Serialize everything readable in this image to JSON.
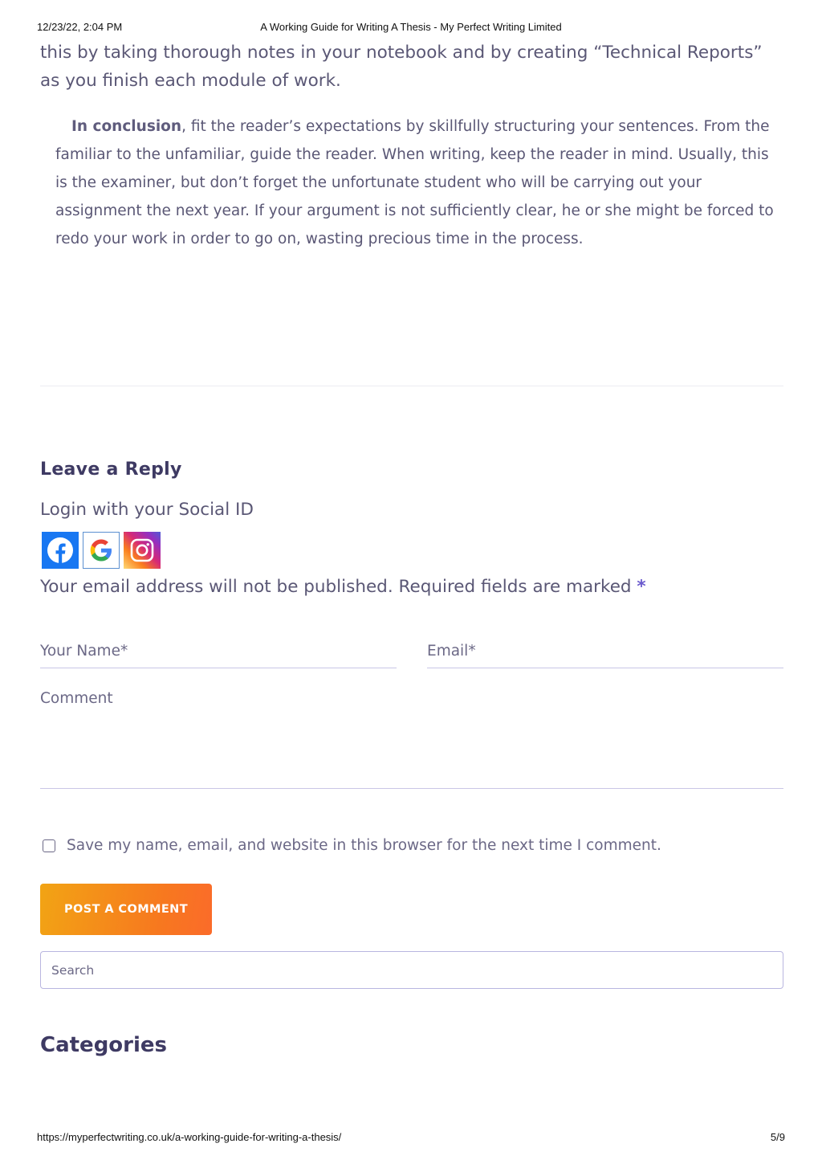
{
  "print_header": {
    "datetime": "12/23/22, 2:04 PM",
    "title": "A Working Guide for Writing A Thesis - My Perfect Writing Limited"
  },
  "article": {
    "intro_text": "this by taking thorough notes in your notebook and by creating “Technical Reports” as you finish each module of work.",
    "conclusion_lead": "In conclusion",
    "conclusion_text": ", fit the reader’s expectations by skillfully structuring your sentences. From the familiar to the unfamiliar, guide the reader. When writing, keep the reader in mind. Usually, this is the examiner, but don’t forget the unfortunate student who will be carrying out your assignment the next year. If your argument is not sufficiently clear, he or she might be forced to redo your work in order to go on, wasting precious time in the process."
  },
  "reply": {
    "title": "Leave a Reply",
    "social_login_title": "Login with your Social ID",
    "social_icons": [
      "facebook-icon",
      "google-icon",
      "instagram-icon"
    ],
    "notice": "Your email address will not be published. Required fields are marked",
    "required_mark": "*",
    "name_placeholder": "Your Name*",
    "email_placeholder": "Email*",
    "comment_placeholder": "Comment",
    "save_label": "Save my name, email, and website in this browser for the next time I comment.",
    "save_checked": false,
    "submit_label": "POST A COMMENT"
  },
  "sidebar": {
    "search_placeholder": "Search",
    "categories_title": "Categories"
  },
  "print_footer": {
    "url": "https://myperfectwriting.co.uk/a-working-guide-for-writing-a-thesis/",
    "page": "5/9"
  },
  "colors": {
    "heading": "#3e3a63",
    "body_text": "#5a5775",
    "accent_required": "#6a5acd",
    "button_gradient_start": "#f2a414",
    "button_gradient_end": "#fb6b2a",
    "input_border": "#c9c6e6"
  }
}
